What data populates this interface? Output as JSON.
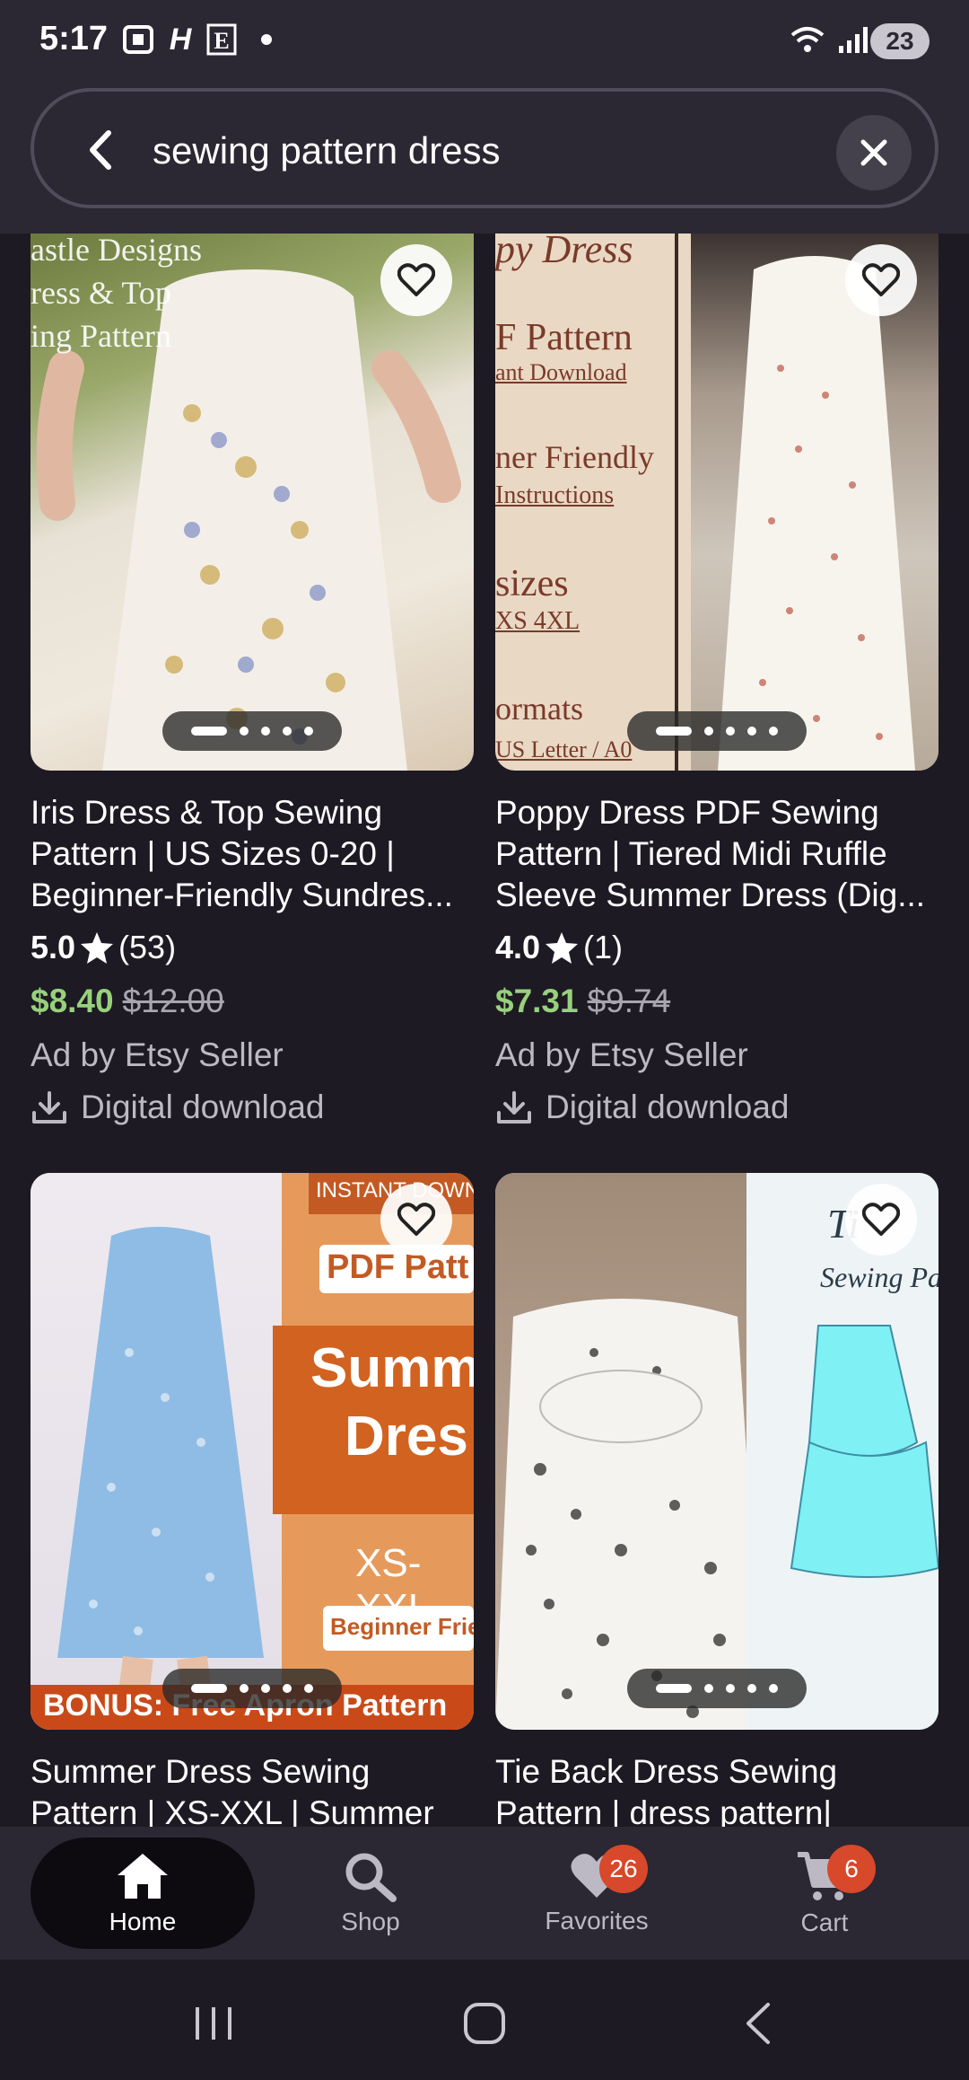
{
  "status_bar": {
    "time": "5:17",
    "battery": "23",
    "icons": [
      "screenshot-icon",
      "h-app-icon",
      "e-app-icon",
      "dot-icon",
      "wifi-icon",
      "signal-icon"
    ]
  },
  "search": {
    "query": "sewing pattern dress"
  },
  "products": [
    {
      "title": "Iris Dress & Top Sewing Pattern | US Sizes 0-20 | Beginner-Friendly Sundres...",
      "rating": "5.0",
      "reviews": "(53)",
      "price": "$8.40",
      "original_price": "$12.00",
      "ad_line": "Ad by Etsy Seller",
      "download_label": "Digital download",
      "image_overlay_lines": [
        "astle Designs",
        "ress & Top",
        "ing Pattern"
      ]
    },
    {
      "title": "Poppy Dress PDF Sewing Pattern | Tiered Midi Ruffle Sleeve Summer Dress (Dig...",
      "rating": "4.0",
      "reviews": "(1)",
      "price": "$7.31",
      "original_price": "$9.74",
      "ad_line": "Ad by Etsy Seller",
      "download_label": "Digital download",
      "image_overlay_lines": [
        "py Dress",
        "F Pattern",
        "ant Download",
        "ner Friendly",
        "Instructions",
        "sizes",
        "XS   4XL",
        "ormats",
        "US Letter / A0"
      ]
    },
    {
      "title": "Summer Dress Sewing Pattern | XS-XXL | Summer",
      "image_overlay_lines": [
        "INSTANT DOWNL",
        "PDF Patt",
        "Summ",
        "Dres",
        "XS-XXL",
        "Beginner Frie",
        "BONUS: Free Apron Pattern"
      ]
    },
    {
      "title": "Tie Back Dress Sewing Pattern | dress pattern|",
      "image_overlay_lines": [
        "Ti",
        "Sewing Pa"
      ]
    }
  ],
  "bottom_nav": {
    "items": [
      {
        "label": "Home"
      },
      {
        "label": "Shop"
      },
      {
        "label": "Favorites",
        "badge": "26"
      },
      {
        "label": "Cart",
        "badge": "6"
      }
    ]
  },
  "colors": {
    "background": "#1d1a24",
    "header": "#2b2733",
    "price_green": "#98d17b",
    "badge_red": "#d8482a"
  }
}
